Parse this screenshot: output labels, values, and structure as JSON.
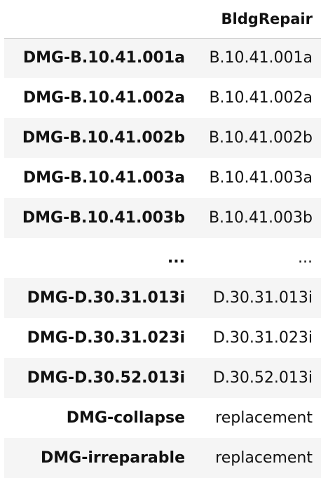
{
  "table": {
    "index_header": "",
    "column_header": "BldgRepair",
    "rows": [
      {
        "index": "DMG-B.10.41.001a",
        "value": "B.10.41.001a"
      },
      {
        "index": "DMG-B.10.41.002a",
        "value": "B.10.41.002a"
      },
      {
        "index": "DMG-B.10.41.002b",
        "value": "B.10.41.002b"
      },
      {
        "index": "DMG-B.10.41.003a",
        "value": "B.10.41.003a"
      },
      {
        "index": "DMG-B.10.41.003b",
        "value": "B.10.41.003b"
      },
      {
        "index": "...",
        "value": "..."
      },
      {
        "index": "DMG-D.30.31.013i",
        "value": "D.30.31.013i"
      },
      {
        "index": "DMG-D.30.31.023i",
        "value": "D.30.31.023i"
      },
      {
        "index": "DMG-D.30.52.013i",
        "value": "D.30.52.013i"
      },
      {
        "index": "DMG-collapse",
        "value": "replacement"
      },
      {
        "index": "DMG-irreparable",
        "value": "replacement"
      }
    ]
  },
  "colors": {
    "text": "#111111",
    "stripe": "#f5f5f5",
    "header_rule": "#c9c9c9",
    "background": "#ffffff"
  }
}
